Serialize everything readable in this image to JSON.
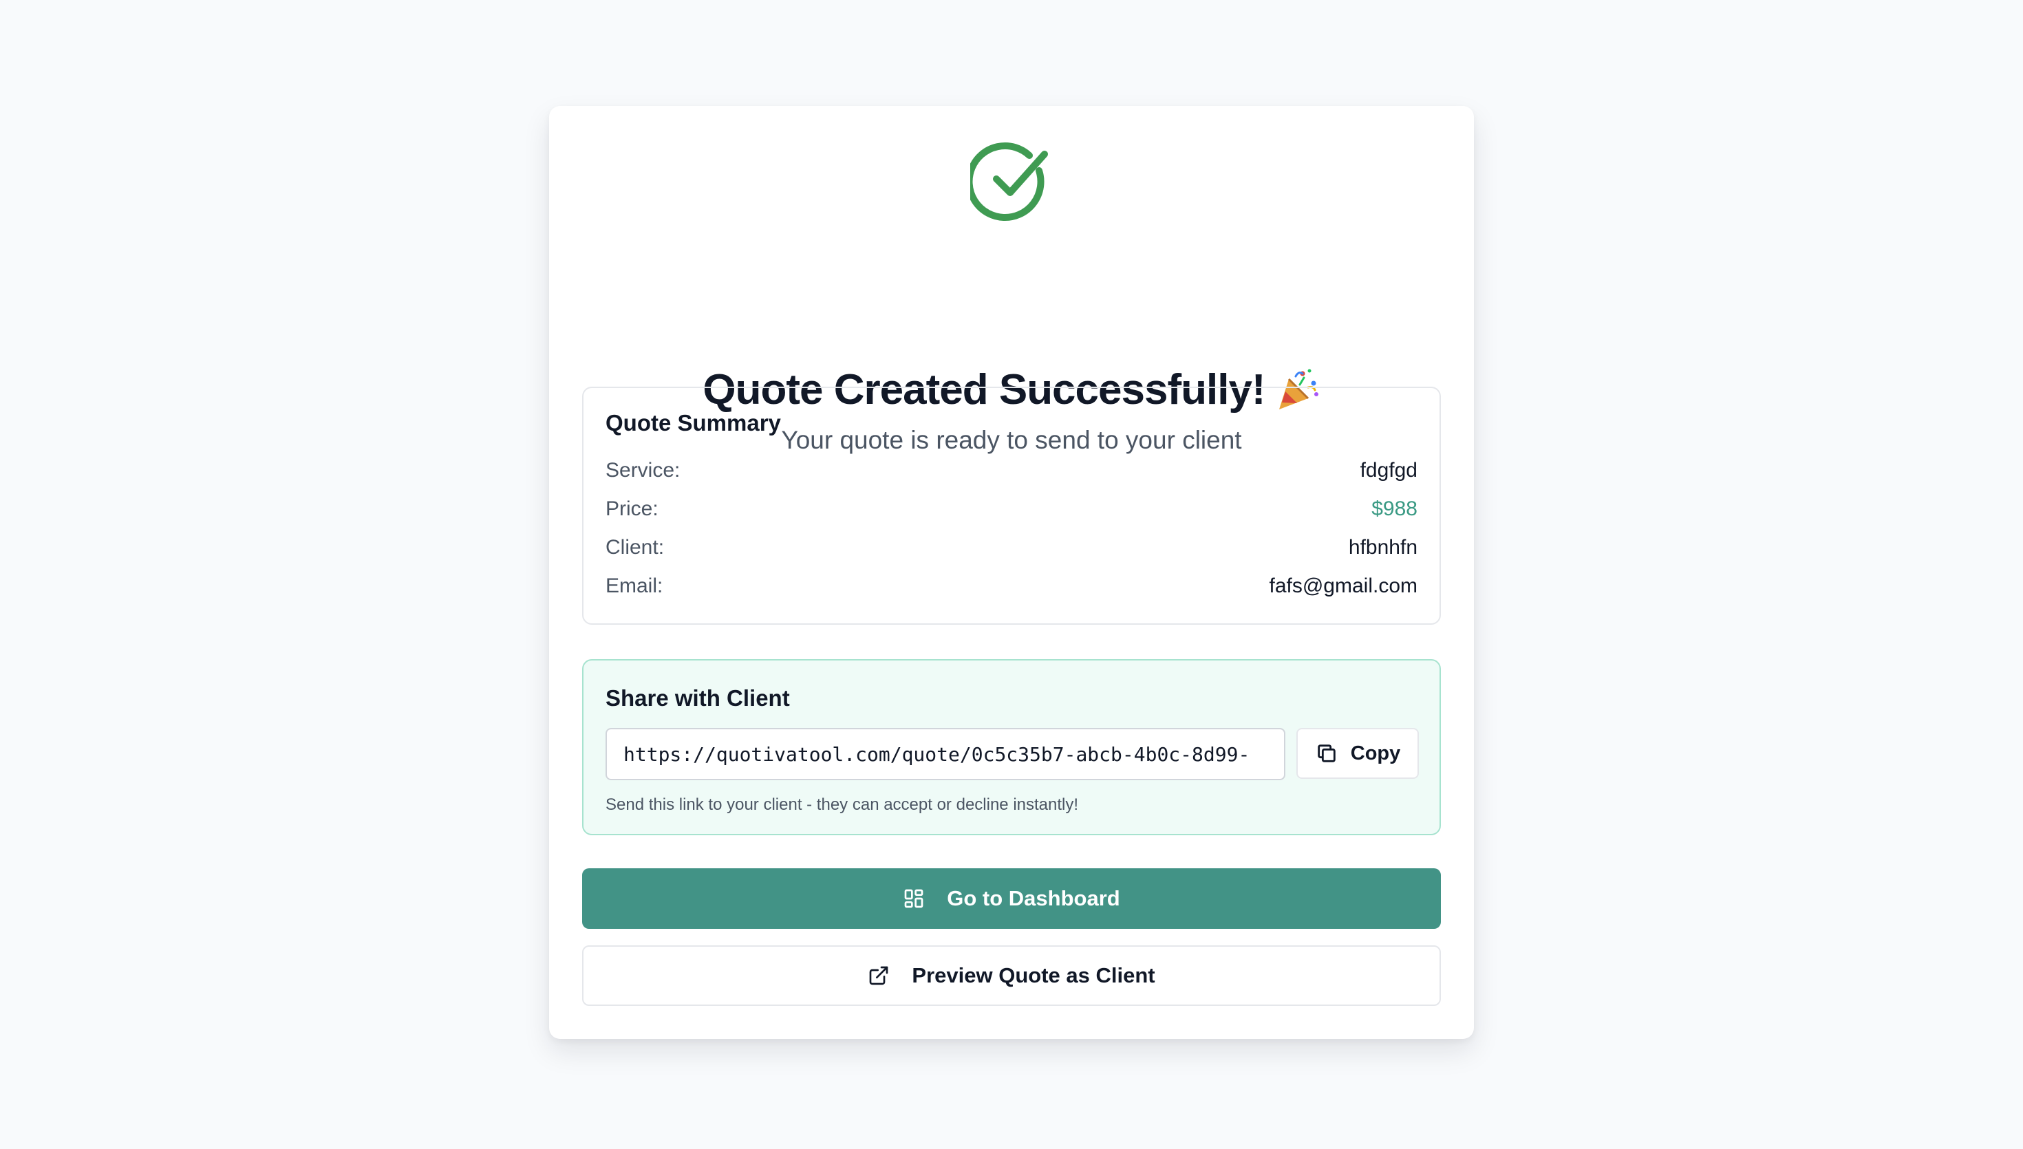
{
  "header": {
    "title": "Quote Created Successfully!",
    "subtitle": "Your quote is ready to send to your client",
    "icon": "check-circle-icon",
    "emoji_icon": "party-popper-icon"
  },
  "summary": {
    "title": "Quote Summary",
    "rows": [
      {
        "label": "Service:",
        "value": "fdgfgd"
      },
      {
        "label": "Price:",
        "value": "$988"
      },
      {
        "label": "Client:",
        "value": "hfbnhfn"
      },
      {
        "label": "Email:",
        "value": "fafs@gmail.com"
      }
    ]
  },
  "share": {
    "title": "Share with Client",
    "link": "https://quotivatool.com/quote/0c5c35b7-abcb-4b0c-8d99-",
    "copy_label": "Copy",
    "hint": "Send this link to your client - they can accept or decline instantly!"
  },
  "actions": {
    "dashboard_label": "Go to Dashboard",
    "preview_label": "Preview Quote as Client"
  },
  "colors": {
    "accent": "#429386",
    "success": "#3f9b52",
    "price": "#3a9a84",
    "background": "#f8fafc"
  }
}
